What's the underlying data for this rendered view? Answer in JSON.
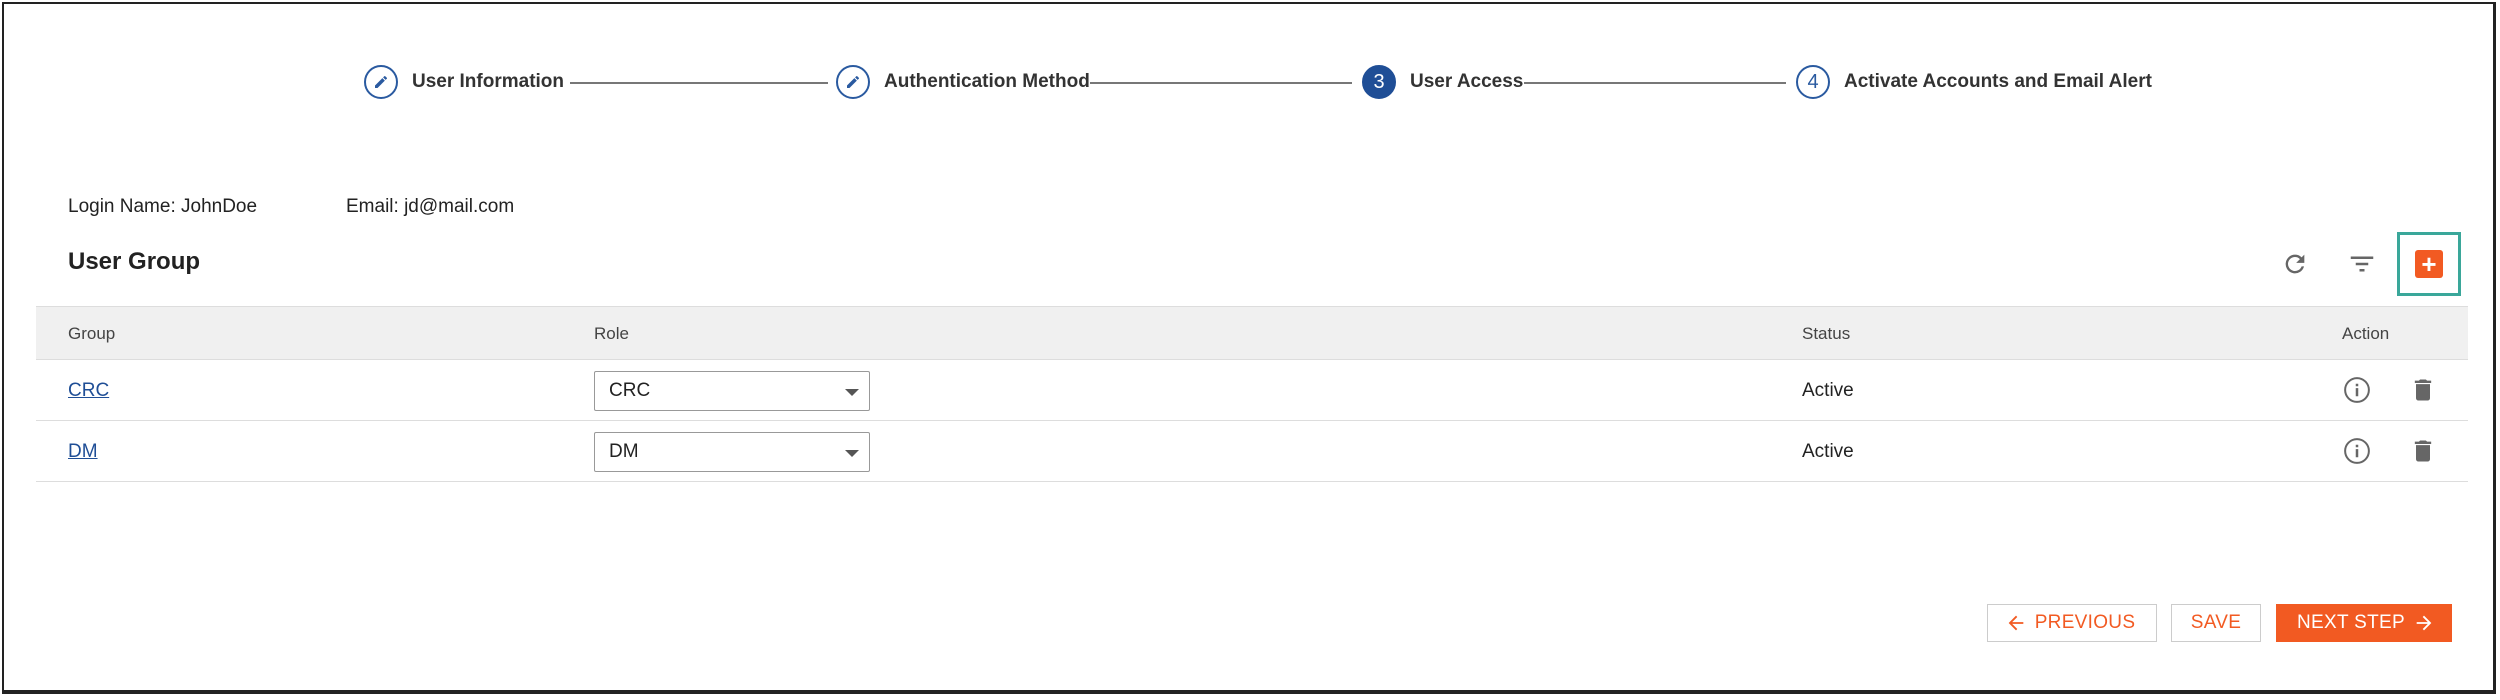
{
  "stepper": {
    "steps": [
      {
        "number": "",
        "icon": "pencil-icon",
        "label": "User Information",
        "state": "done"
      },
      {
        "number": "",
        "icon": "pencil-icon",
        "label": "Authentication Method",
        "state": "done"
      },
      {
        "number": "3",
        "label": "User Access",
        "state": "active"
      },
      {
        "number": "4",
        "label": "Activate Accounts and Email Alert",
        "state": "pending"
      }
    ]
  },
  "user": {
    "login": "Login Name: JohnDoe",
    "email": "Email: jd@mail.com"
  },
  "section": {
    "title": "User Group",
    "tools": [
      "refresh-icon",
      "filter-icon",
      "add-icon"
    ]
  },
  "table": {
    "headers": {
      "group": "Group",
      "role": "Role",
      "status": "Status",
      "action": "Action"
    },
    "rows": [
      {
        "group": "CRC",
        "role": "CRC",
        "status": "Active"
      },
      {
        "group": "DM",
        "role": "DM",
        "status": "Active"
      }
    ]
  },
  "footer": {
    "previous": "PREVIOUS",
    "save": "SAVE",
    "next": "NEXT STEP"
  },
  "colors": {
    "accent": "#f25a22",
    "primary": "#1f4e96",
    "highlight": "#3aa79a"
  }
}
